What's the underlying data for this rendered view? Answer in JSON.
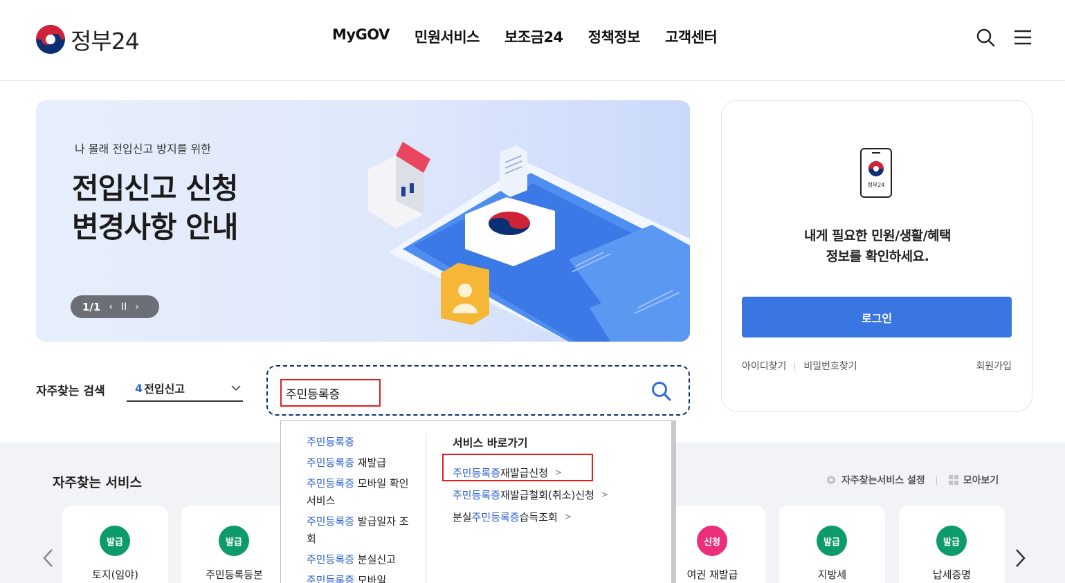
{
  "header": {
    "logo_text": "정부24",
    "nav": [
      "MyGOV",
      "민원서비스",
      "보조금24",
      "정책정보",
      "고객센터"
    ],
    "search_icon": "search-icon",
    "menu_icon": "hamburger-icon"
  },
  "banner": {
    "subtitle": "나 몰래 전입신고 방지를 위한",
    "title_line1": "전입신고 신청",
    "title_line2": "변경사항 안내",
    "page": "1/1",
    "prev": "‹",
    "pause": "II",
    "next": "›"
  },
  "login": {
    "phone_label": "정부24",
    "message_line1": "내게 필요한 민원/생활/혜택",
    "message_line2": "정보를 확인하세요.",
    "login_button": "로그인",
    "find_id": "아이디찾기",
    "find_password": "비밀번호찾기",
    "signup": "회원가입"
  },
  "search": {
    "frequent_label": "자주찾는 검색",
    "keyword_num": "4",
    "keyword_text": "전입신고",
    "input_value": "주민등록증"
  },
  "autocomplete": {
    "suggestions": [
      {
        "hl": "주민등록증",
        "rest": ""
      },
      {
        "hl": "주민등록증",
        "rest": " 재발급"
      },
      {
        "hl": "주민등록증",
        "rest": " 모바일 확인 서비스"
      },
      {
        "hl": "주민등록증",
        "rest": " 발급일자 조회"
      },
      {
        "hl": "주민등록증",
        "rest": " 분실신고"
      },
      {
        "hl": "주민등록증",
        "rest": " 모바일"
      }
    ],
    "shortcut_title": "서비스 바로가기",
    "shortcuts": [
      {
        "pre": "",
        "hl": "주민등록증",
        "rest": "재발급신청"
      },
      {
        "pre": "",
        "hl": "주민등록증",
        "rest": "재발급철회(취소)신청"
      },
      {
        "pre": "분실",
        "hl": "주민등록증",
        "rest": " 습득조회"
      }
    ],
    "arrow": ">"
  },
  "frequent_services": {
    "title": "자주찾는 서비스",
    "settings": "자주찾는서비스 설정",
    "view_all": "모아보기",
    "cards": [
      {
        "badge": "발급",
        "name": "토지(임야)",
        "color": "#0e9b6a"
      },
      {
        "badge": "발급",
        "name": "주민등록등본",
        "color": "#0e9b6a"
      },
      {
        "badge": "신청",
        "name": "여권 재발급",
        "color": "#ec2f7a"
      },
      {
        "badge": "발급",
        "name": "지방세",
        "color": "#0e9b6a"
      },
      {
        "badge": "발급",
        "name": "납세증명",
        "color": "#0e9b6a"
      }
    ]
  },
  "colors": {
    "primary": "#3976e2",
    "navy": "#0b2f73",
    "highlight": "#2a5fce",
    "annotation_red": "#e11d1d"
  }
}
